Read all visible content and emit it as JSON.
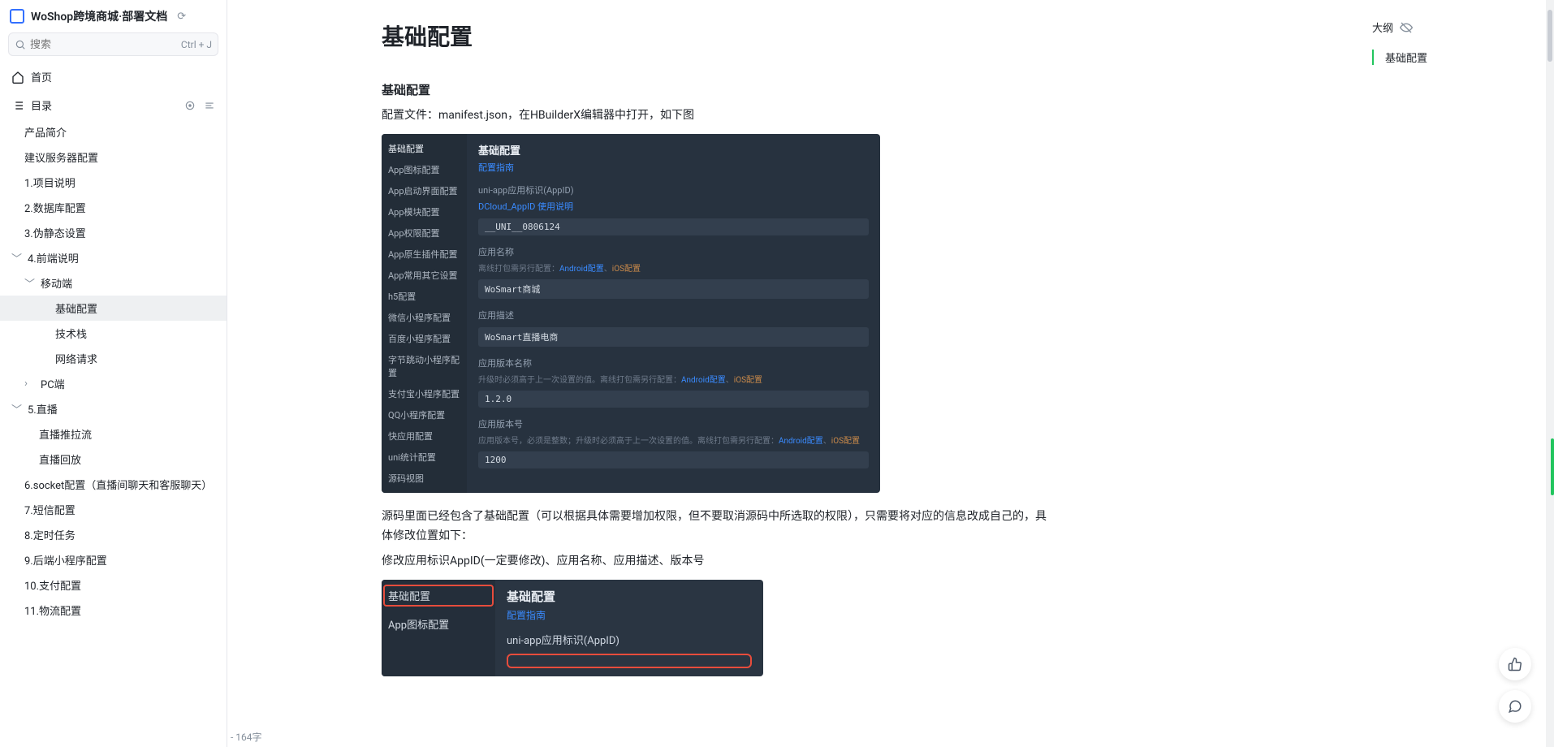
{
  "header": {
    "doc_title": "WoShop跨境商城·部署文档"
  },
  "search": {
    "placeholder": "搜索",
    "shortcut": "Ctrl + J"
  },
  "home_label": "首页",
  "toc_label": "目录",
  "nav": [
    {
      "label": "产品简介",
      "indent": 1
    },
    {
      "label": "建议服务器配置",
      "indent": 1
    },
    {
      "label": "1.项目说明",
      "indent": 1
    },
    {
      "label": "2.数据库配置",
      "indent": 1
    },
    {
      "label": "3.伪静态设置",
      "indent": 1
    },
    {
      "label": "4.前端说明",
      "indent": 1,
      "chev": "down"
    },
    {
      "label": "移动端",
      "indent": 2,
      "chev": "down"
    },
    {
      "label": "基础配置",
      "indent": 3,
      "active": true
    },
    {
      "label": "技术栈",
      "indent": 3
    },
    {
      "label": "网络请求",
      "indent": 3
    },
    {
      "label": "PC端",
      "indent": 2,
      "chev": "right"
    },
    {
      "label": "5.直播",
      "indent": 1,
      "chev": "down"
    },
    {
      "label": "直播推拉流",
      "indent": 2,
      "noChev": true
    },
    {
      "label": "直播回放",
      "indent": 2,
      "noChev": true
    },
    {
      "label": "6.socket配置（直播间聊天和客服聊天）",
      "indent": 1
    },
    {
      "label": "7.短信配置",
      "indent": 1
    },
    {
      "label": "8.定时任务",
      "indent": 1
    },
    {
      "label": "9.后端小程序配置",
      "indent": 1
    },
    {
      "label": "10.支付配置",
      "indent": 1
    },
    {
      "label": "11.物流配置",
      "indent": 1
    }
  ],
  "wordcount": "- 164字",
  "page": {
    "title": "基础配置",
    "h3": "基础配置",
    "p1": "配置文件：manifest.json，在HBuilderX编辑器中打开，如下图",
    "p2": "源码里面已经包含了基础配置（可以根据具体需要增加权限，但不要取消源码中所选取的权限），只需要将对应的信息改成自己的，具体修改位置如下：",
    "p3": "修改应用标识AppID(一定要修改)、应用名称、应用描述、版本号"
  },
  "shot1": {
    "left_items": [
      "基础配置",
      "App图标配置",
      "App启动界面配置",
      "App模块配置",
      "App权限配置",
      "App原生插件配置",
      "App常用其它设置",
      "h5配置",
      "微信小程序配置",
      "百度小程序配置",
      "字节跳动小程序配置",
      "支付宝小程序配置",
      "QQ小程序配置",
      "快应用配置",
      "uni统计配置",
      "源码视图"
    ],
    "title": "基础配置",
    "guide_link": "配置指南",
    "appid_label": "uni-app应用标识(AppID)",
    "appid_link": "DCloud_AppID 使用说明",
    "appid_value": "__UNI__0806124",
    "appname_label": "应用名称",
    "appname_sub_pre": "离线打包需另行配置：",
    "android_link": "Android配置",
    "ios_link": "iOS配置",
    "appname_value": "WoSmart商城",
    "appdesc_label": "应用描述",
    "appdesc_value": "WoSmart直播电商",
    "vername_label": "应用版本名称",
    "vername_sub": "升级时必须高于上一次设置的值。离线打包需另行配置：",
    "vername_value": "1.2.0",
    "vercode_label": "应用版本号",
    "vercode_sub": "应用版本号，必须是整数；升级时必须高于上一次设置的值。离线打包需另行配置：",
    "vercode_value": "1200"
  },
  "shot2": {
    "left_items": [
      "基础配置",
      "App图标配置"
    ],
    "title": "基础配置",
    "guide_link": "配置指南",
    "appid_label": "uni-app应用标识(AppID)"
  },
  "outline": {
    "head": "大纲",
    "item": "基础配置"
  }
}
